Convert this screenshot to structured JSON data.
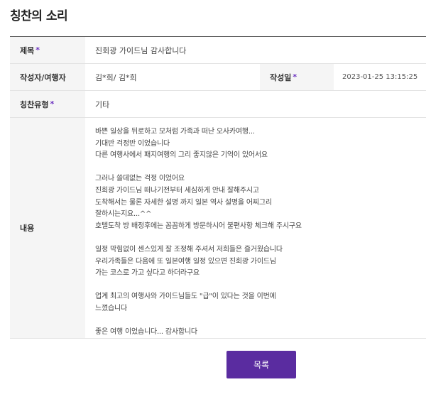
{
  "page": {
    "title": "칭찬의 소리"
  },
  "form": {
    "subject_label": "제목",
    "subject_value": "진회광 가이드님 감사합니다",
    "writer_label": "작성자/여행자",
    "writer_value": "김*희/ 김*희",
    "date_label": "작성일",
    "date_value": "2023-01-25 13:15:25",
    "type_label": "칭찬유형",
    "type_value": "기타",
    "content_label": "내용",
    "required_mark": "*",
    "content_lines": [
      "바쁜 일상을 뒤로하고 모처럼 가족과 떠난 오사카여행...",
      "기대반 걱정반 이었습니다",
      "다른 여행사에서 패지여행의 그리 좋지않은 기억이 있어서요",
      "",
      "그러나 쓸데없는 걱정 이었어요",
      "진회광 가이드님 떠나기전부터 세심하게 안내 잘해주시고",
      "도착해서는 물론 자세한 설명 까지 일본 역사 설명을 어찌그리",
      "잘하시는지요...^^",
      "호텔도착 방 배정후에는 꼼꼼하게 방문하시어 불편사항 체크해 주시구요",
      "",
      "일정 막힘없이 센스있게 잘 조정해 주셔서 저희들은 즐거웠습니다",
      "우리가족들은 다음에 또 일본여행 일정 있으면 진회광 가이드님",
      "가는 코스로 가고 싶다고 하더라구요",
      "",
      "업계 최고의 여행사와 가이드님들도 \"급\"이 있다는 것을 이번에",
      "느꼈습니다",
      "",
      "좋은 여행 이었습니다... 감사합니다"
    ]
  },
  "buttons": {
    "list_label": "목록"
  },
  "colors": {
    "accent": "#5a2ca0",
    "required": "#6a2fbf",
    "label_bg": "#f5f5f5"
  }
}
